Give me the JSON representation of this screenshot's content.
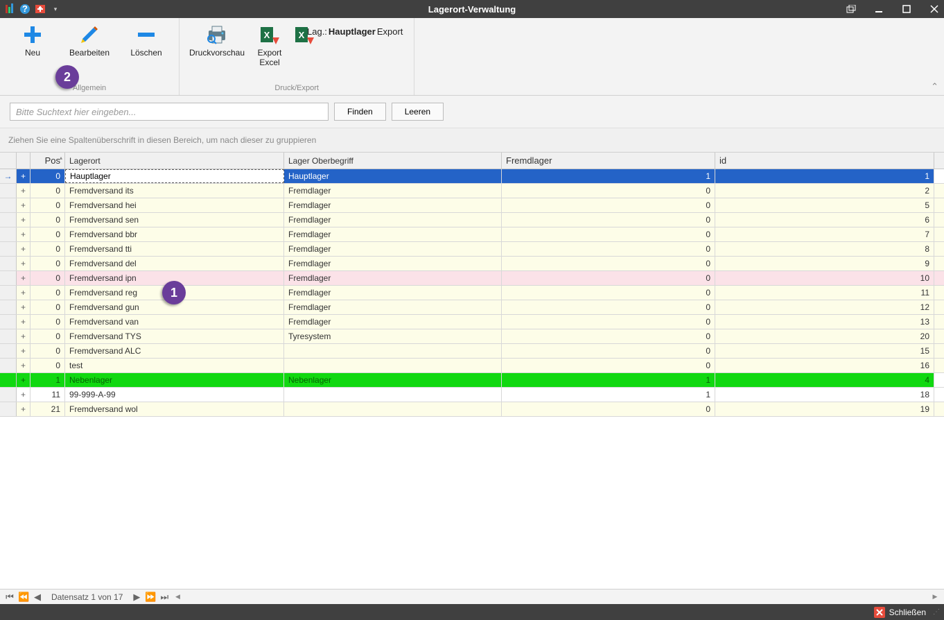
{
  "window": {
    "title": "Lagerort-Verwaltung"
  },
  "ribbon": {
    "groups": [
      {
        "label": "Allgemein",
        "items": [
          {
            "key": "neu",
            "label": "Neu"
          },
          {
            "key": "bearbeiten",
            "label": "Bearbeiten"
          },
          {
            "key": "loeschen",
            "label": "Löschen"
          }
        ]
      },
      {
        "label": "Druck/Export",
        "items": [
          {
            "key": "druckvorschau",
            "label": "Druckvorschau"
          },
          {
            "key": "export-excel",
            "label": "Export Excel"
          }
        ],
        "text_item": {
          "prefix": "Lag.: ",
          "bold": "Hauptlager",
          "suffix": " Export"
        }
      }
    ]
  },
  "search": {
    "placeholder": "Bitte Suchtext hier eingeben...",
    "find_label": "Finden",
    "clear_label": "Leeren"
  },
  "group_panel": "Ziehen Sie eine Spaltenüberschrift in diesen Bereich, um nach dieser zu gruppieren",
  "columns": {
    "pos": "Pos",
    "lagerort": "Lagerort",
    "oberbegriff": "Lager Oberbegriff",
    "fremd": "Fremdlager",
    "id": "id"
  },
  "rows": [
    {
      "pos": 0,
      "lagerort": "Hauptlager",
      "ober": "Hauptlager",
      "fremd": 1,
      "id": 1,
      "style": "sel",
      "indicator": true
    },
    {
      "pos": 0,
      "lagerort": "Fremdversand its",
      "ober": "Fremdlager",
      "fremd": 0,
      "id": 2,
      "style": "alt"
    },
    {
      "pos": 0,
      "lagerort": "Fremdversand hei",
      "ober": "Fremdlager",
      "fremd": 0,
      "id": 5,
      "style": "alt"
    },
    {
      "pos": 0,
      "lagerort": "Fremdversand sen",
      "ober": "Fremdlager",
      "fremd": 0,
      "id": 6,
      "style": "alt"
    },
    {
      "pos": 0,
      "lagerort": "Fremdversand bbr",
      "ober": "Fremdlager",
      "fremd": 0,
      "id": 7,
      "style": "alt"
    },
    {
      "pos": 0,
      "lagerort": "Fremdversand tti",
      "ober": "Fremdlager",
      "fremd": 0,
      "id": 8,
      "style": "alt"
    },
    {
      "pos": 0,
      "lagerort": "Fremdversand del",
      "ober": "Fremdlager",
      "fremd": 0,
      "id": 9,
      "style": "alt"
    },
    {
      "pos": 0,
      "lagerort": "Fremdversand ipn",
      "ober": "Fremdlager",
      "fremd": 0,
      "id": 10,
      "style": "pink"
    },
    {
      "pos": 0,
      "lagerort": "Fremdversand reg",
      "ober": "Fremdlager",
      "fremd": 0,
      "id": 11,
      "style": "alt"
    },
    {
      "pos": 0,
      "lagerort": "Fremdversand gun",
      "ober": "Fremdlager",
      "fremd": 0,
      "id": 12,
      "style": "alt"
    },
    {
      "pos": 0,
      "lagerort": "Fremdversand van",
      "ober": "Fremdlager",
      "fremd": 0,
      "id": 13,
      "style": "alt"
    },
    {
      "pos": 0,
      "lagerort": "Fremdversand TYS",
      "ober": "Tyresystem",
      "fremd": 0,
      "id": 20,
      "style": "alt"
    },
    {
      "pos": 0,
      "lagerort": "Fremdversand ALC",
      "ober": "",
      "fremd": 0,
      "id": 15,
      "style": "alt"
    },
    {
      "pos": 0,
      "lagerort": "test",
      "ober": "",
      "fremd": 0,
      "id": 16,
      "style": "alt"
    },
    {
      "pos": 1,
      "lagerort": "Nebenlager",
      "ober": "Nebenlager",
      "fremd": 1,
      "id": 4,
      "style": "green"
    },
    {
      "pos": 11,
      "lagerort": "99-999-A-99",
      "ober": "",
      "fremd": 1,
      "id": 18,
      "style": ""
    },
    {
      "pos": 21,
      "lagerort": "Fremdversand wol",
      "ober": "",
      "fremd": 0,
      "id": 19,
      "style": "alt"
    }
  ],
  "navigator": {
    "text": "Datensatz 1 von 17"
  },
  "statusbar": {
    "close": "Schließen"
  },
  "callouts": {
    "one": "1",
    "two": "2"
  }
}
